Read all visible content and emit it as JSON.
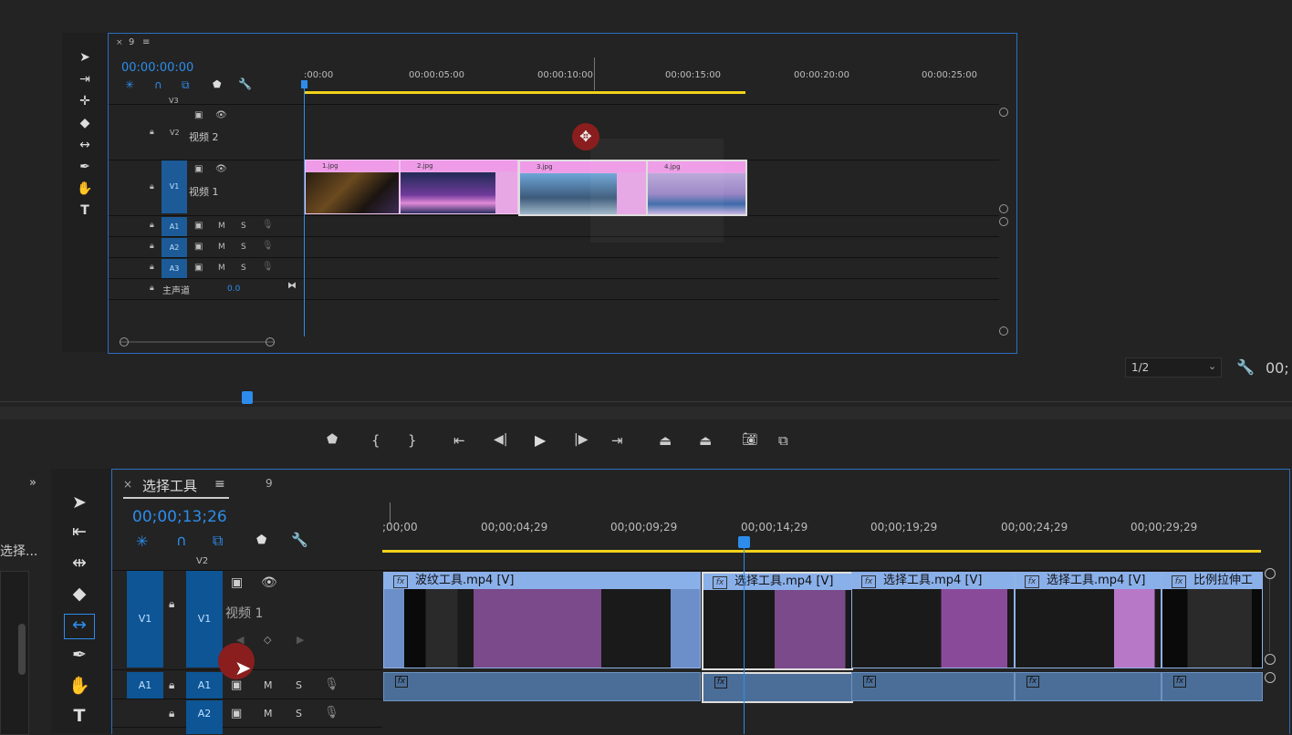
{
  "top_panel": {
    "tab_number": "9",
    "timecode": "00:00:00:00",
    "ruler_labels": [
      ":00:00",
      "00:00:05:00",
      "00:00:10:00",
      "00:00:15:00",
      "00:00:20:00",
      "00:00:25:00"
    ],
    "tracks": {
      "v3": "V3",
      "v2": {
        "id": "V2",
        "name": "视频 2"
      },
      "v1": {
        "id": "V1",
        "name": "视频 1"
      },
      "audio": [
        {
          "id": "A1",
          "m": "M",
          "s": "S"
        },
        {
          "id": "A2",
          "m": "M",
          "s": "S"
        },
        {
          "id": "A3",
          "m": "M",
          "s": "S"
        }
      ],
      "master": {
        "name": "主声道",
        "value": "0.0"
      }
    },
    "clips": [
      "1.jpg",
      "2.jpg",
      "3.jpg",
      "4.jpg"
    ]
  },
  "monitor": {
    "page_select": "1/2",
    "timecode_partial": "00;"
  },
  "bottom_panel": {
    "tab_title": "选择工具",
    "tab_number": "9",
    "left_label": "选择...",
    "timecode": "00;00;13;26",
    "ruler_labels": [
      ";00;00",
      "00;00;04;29",
      "00;00;09;29",
      "00;00;14;29",
      "00;00;19;29",
      "00;00;24;29",
      "00;00;29;29"
    ],
    "tracks": {
      "v2": "V2",
      "v1": {
        "src": "V1",
        "id": "V1",
        "name": "视频 1"
      },
      "a1": {
        "src": "A1",
        "id": "A1",
        "m": "M",
        "s": "S"
      },
      "a2": {
        "id": "A2",
        "m": "M",
        "s": "S"
      }
    },
    "video_clips": [
      {
        "label": "波纹工具.mp4 [V]"
      },
      {
        "label": "选择工具.mp4 [V]"
      },
      {
        "label": "选择工具.mp4 [V]"
      },
      {
        "label": "选择工具.mp4 [V]"
      },
      {
        "label": "比例拉伸工"
      }
    ],
    "fx_label": "fx"
  },
  "colors": {
    "accent_blue": "#2d8ceb",
    "work_area_yellow": "#f2d21b",
    "clip_pink": "#e7a6e4",
    "clip_blue": "#8ab0ea"
  }
}
